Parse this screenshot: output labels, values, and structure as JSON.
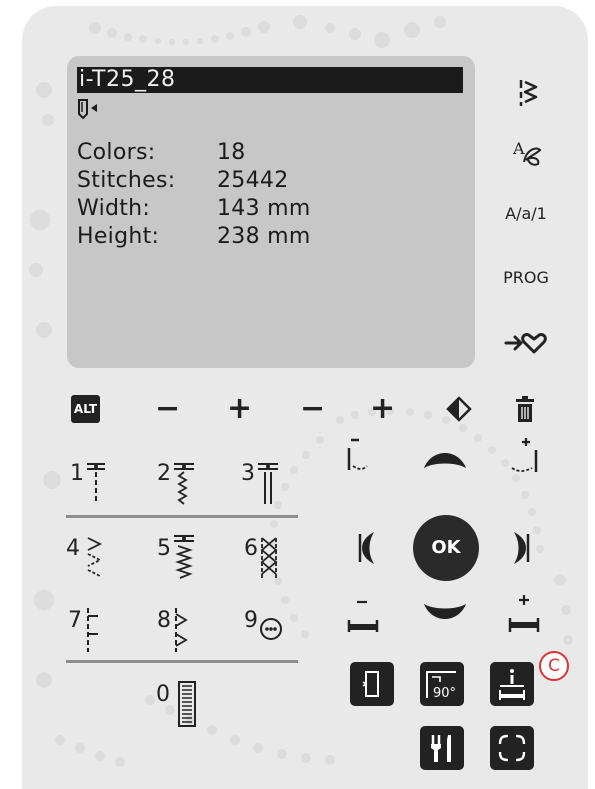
{
  "screen": {
    "title": "i-T25_28",
    "info": [
      {
        "label": "Colors:",
        "value": "18"
      },
      {
        "label": "Stitches:",
        "value": "25442"
      },
      {
        "label": "Width:",
        "value": "143 mm"
      },
      {
        "label": "Height:",
        "value": "238 mm"
      }
    ]
  },
  "side_buttons": {
    "menu_icon": "stitch-menu-icon",
    "font_icon": "font-menu-icon",
    "case_label": "A/a/1",
    "prog_label": "PROG",
    "favorite_icon": "save-favorite-icon"
  },
  "controls": {
    "alt_label": "ALT",
    "minus": "−",
    "plus": "+",
    "mirror_icon": "mirror-icon",
    "delete_icon": "trash-icon"
  },
  "stitches": {
    "numbers": [
      "1",
      "2",
      "3",
      "4",
      "5",
      "6",
      "7",
      "8",
      "9",
      "0"
    ]
  },
  "navigation": {
    "ok_label": "OK"
  },
  "bottom_buttons": {
    "hoop_icon": "hoop-icon",
    "rotate_label": "90°",
    "info_icon": "info-icon",
    "tools_icon": "tools-icon",
    "fullscreen_icon": "fullscreen-icon"
  },
  "callout": {
    "label": "C",
    "color": "#d33333"
  }
}
